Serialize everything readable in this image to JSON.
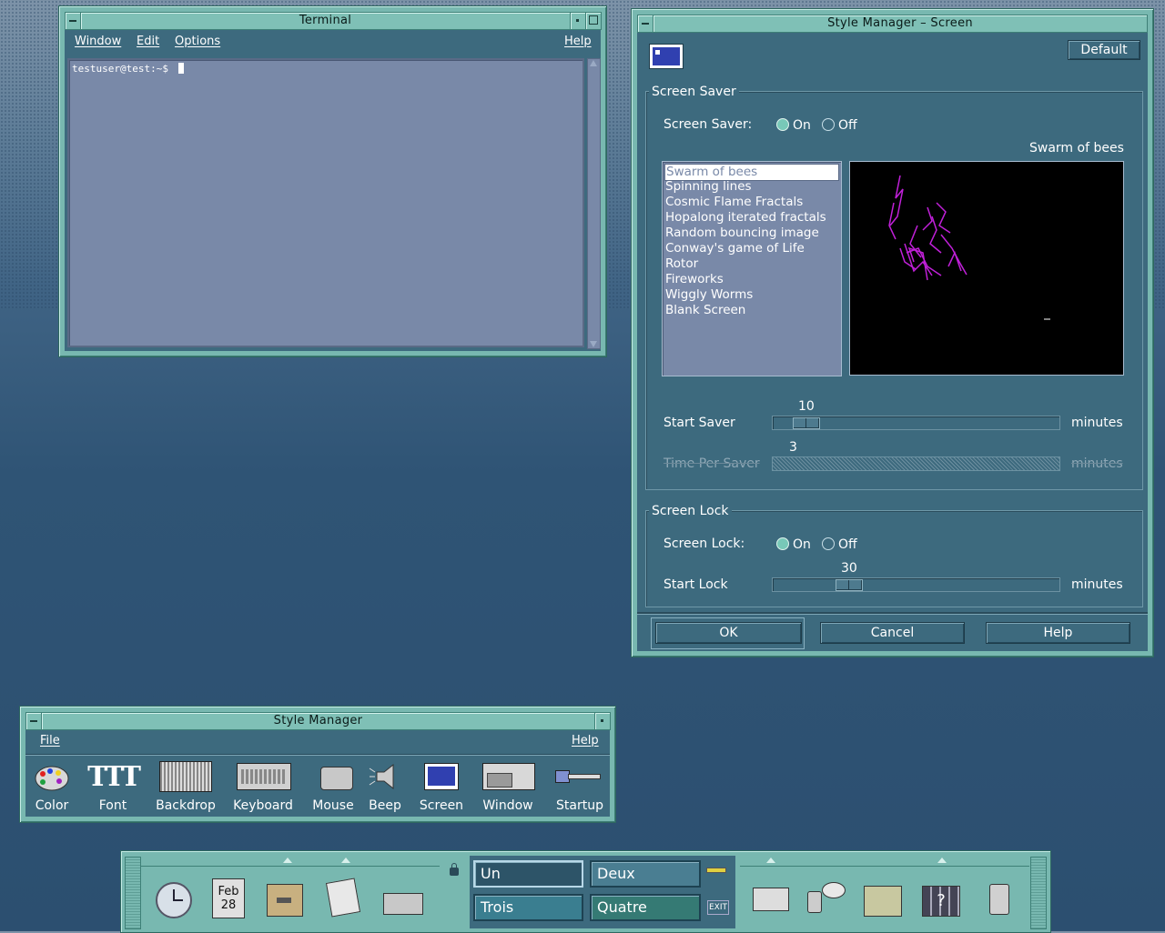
{
  "colors": {
    "desktop": "#2f5475",
    "window_frame": "#78b8b0",
    "client": "#3d6a7e",
    "terminal_bg": "#7989a8",
    "saver_purple": "#c020d8"
  },
  "terminal": {
    "title": "Terminal",
    "menu": [
      "Window",
      "Edit",
      "Options"
    ],
    "help": "Help",
    "prompt": "testuser@test:~$ "
  },
  "screen_dialog": {
    "title": "Style Manager – Screen",
    "default_button": "Default",
    "saver_group": "Screen Saver",
    "saver_label": "Screen Saver:",
    "on": "On",
    "off": "Off",
    "preview_name": "Swarm of bees",
    "savers": [
      "Swarm of bees",
      "Spinning lines",
      "Cosmic Flame Fractals",
      "Hopalong iterated fractals",
      "Random bouncing image",
      "Conway's game of Life",
      "Rotor",
      "Fireworks",
      "Wiggly Worms",
      "Blank Screen"
    ],
    "start_saver_label": "Start Saver",
    "start_saver_value": "10",
    "time_per_saver_label": "Time Per Saver",
    "time_per_saver_value": "3",
    "minutes": "minutes",
    "lock_group": "Screen Lock",
    "lock_label": "Screen Lock:",
    "start_lock_label": "Start Lock",
    "start_lock_value": "30",
    "ok": "OK",
    "cancel": "Cancel",
    "help": "Help"
  },
  "style_manager": {
    "title": "Style Manager",
    "file": "File",
    "help": "Help",
    "icons": [
      "Color",
      "Font",
      "Backdrop",
      "Keyboard",
      "Mouse",
      "Beep",
      "Screen",
      "Window",
      "Startup"
    ],
    "font_icon_text": "TTT"
  },
  "front_panel": {
    "calendar_month": "Feb",
    "calendar_day": "28",
    "workspaces": [
      "Un",
      "Deux",
      "Trois",
      "Quatre"
    ],
    "exit": "EXIT"
  }
}
